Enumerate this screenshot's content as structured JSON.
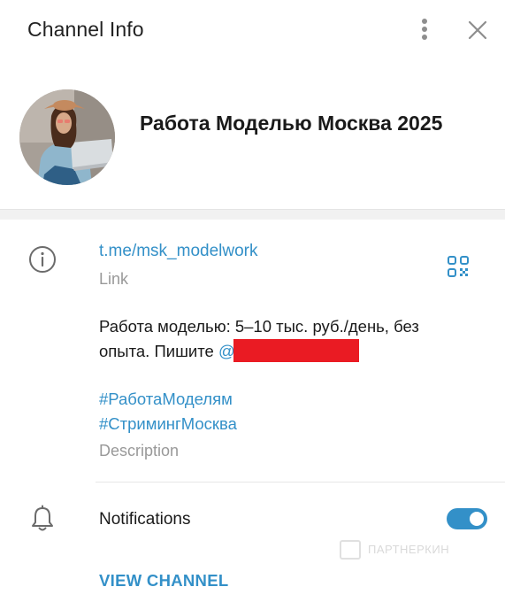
{
  "header": {
    "title": "Channel Info",
    "more_icon": "vertical-dots-icon",
    "close_icon": "close-icon"
  },
  "channel": {
    "name": "Работа Моделью Москва 2025",
    "avatar": "channel-avatar-photo"
  },
  "info": {
    "link": "t.me/msk_modelwork",
    "link_caption": "Link",
    "description_text": "Работа моделью: 5–10 тыс. руб./день, без опыта. Пишите ",
    "mention_prefix": "@",
    "hashtags": [
      "#РаботаМоделям",
      "#СтримингМосква"
    ],
    "description_caption": "Description"
  },
  "notifications": {
    "label": "Notifications",
    "enabled": true
  },
  "watermark": "ПАРТНЕРКИН",
  "actions": {
    "view_channel": "VIEW CHANNEL"
  },
  "colors": {
    "accent": "#3390c8",
    "redaction": "#ea1b23",
    "muted": "#999999"
  }
}
